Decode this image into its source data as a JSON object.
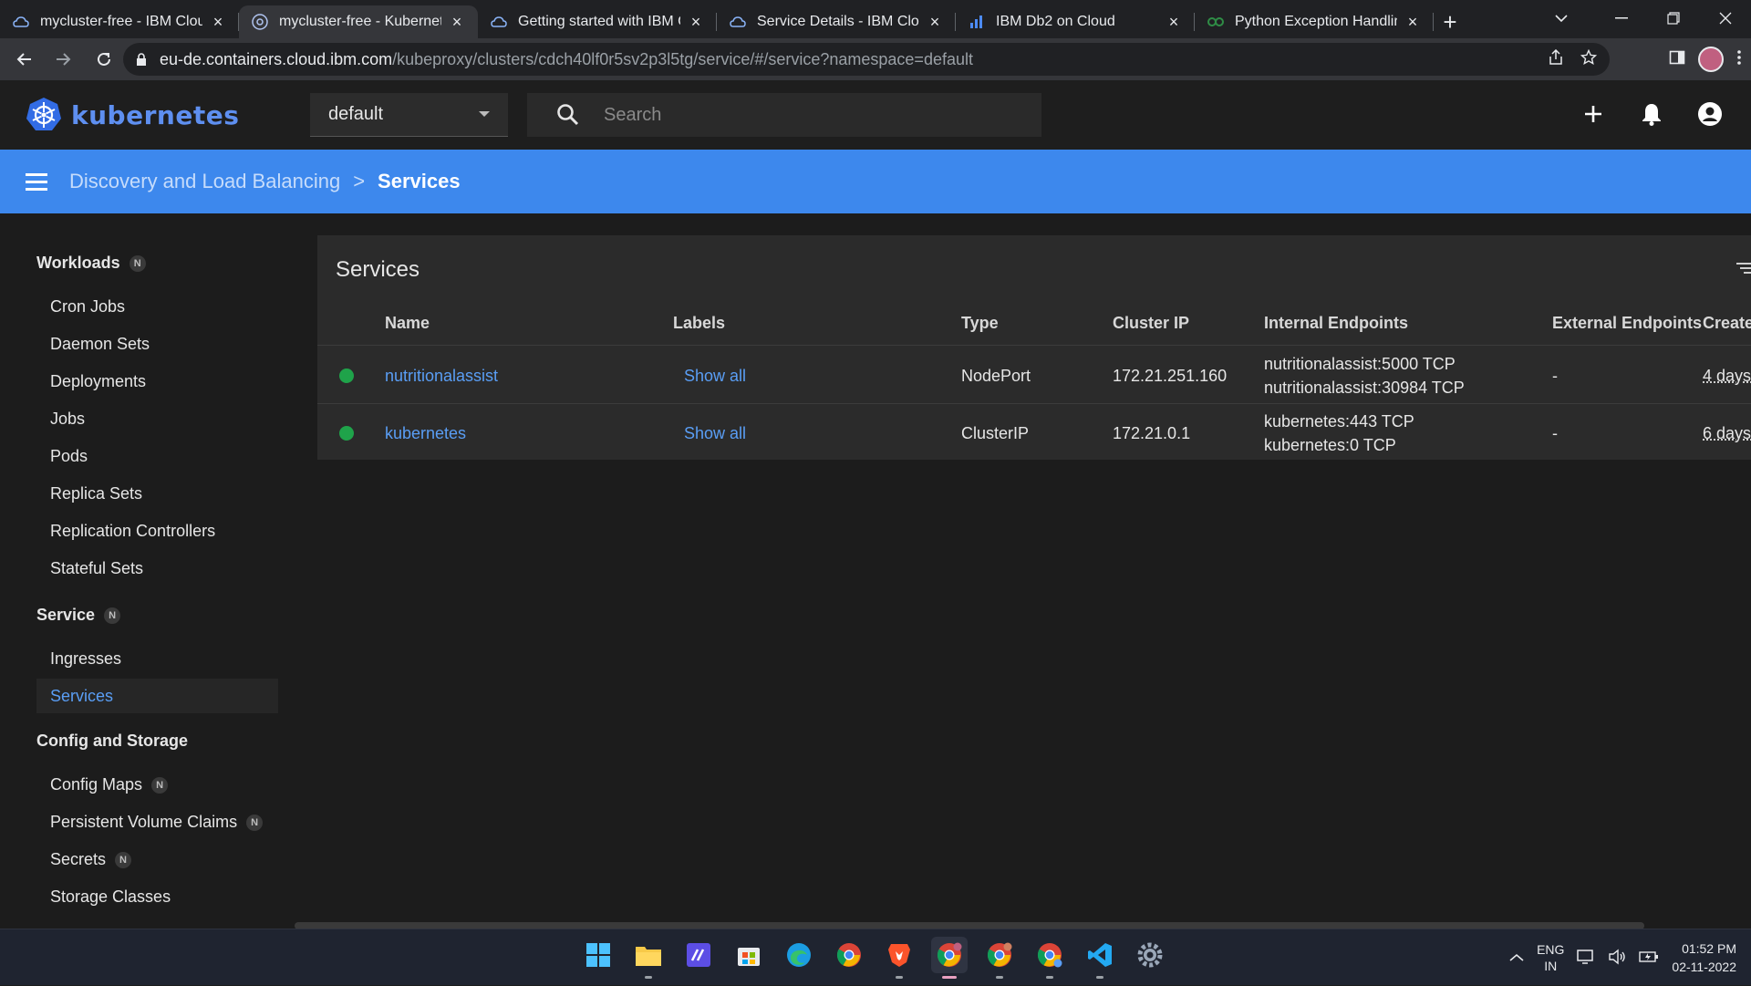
{
  "browser": {
    "tabs": [
      {
        "title": "mycluster-free - IBM Cloud",
        "active": false
      },
      {
        "title": "mycluster-free - Kubernetes",
        "active": true
      },
      {
        "title": "Getting started with IBM Cloud",
        "active": false
      },
      {
        "title": "Service Details - IBM Cloud",
        "active": false
      },
      {
        "title": "IBM Db2 on Cloud",
        "active": false
      },
      {
        "title": "Python Exception Handling",
        "active": false
      }
    ],
    "url_host": "eu-de.containers.cloud.ibm.com",
    "url_path": "/kubeproxy/clusters/cdch40lf0r5sv2p3l5tg/service/#/service?namespace=default"
  },
  "app": {
    "logo_text": "kubernetes",
    "namespace": "default",
    "search_placeholder": "Search"
  },
  "breadcrumb": {
    "parent": "Discovery and Load Balancing",
    "separator": ">",
    "current": "Services"
  },
  "sidebar": {
    "workloads": {
      "label": "Workloads",
      "badge": "N"
    },
    "workload_items": [
      "Cron Jobs",
      "Daemon Sets",
      "Deployments",
      "Jobs",
      "Pods",
      "Replica Sets",
      "Replication Controllers",
      "Stateful Sets"
    ],
    "service": {
      "label": "Service",
      "badge": "N"
    },
    "service_items": [
      "Ingresses",
      "Services"
    ],
    "config": {
      "label": "Config and Storage"
    },
    "config_items": [
      {
        "label": "Config Maps",
        "badge": "N"
      },
      {
        "label": "Persistent Volume Claims",
        "badge": "N"
      },
      {
        "label": "Secrets",
        "badge": "N"
      },
      {
        "label": "Storage Classes",
        "badge": ""
      }
    ]
  },
  "services_table": {
    "title": "Services",
    "columns": [
      "Name",
      "Labels",
      "Type",
      "Cluster IP",
      "Internal Endpoints",
      "External Endpoints",
      "Create"
    ],
    "rows": [
      {
        "name": "nutritionalassist",
        "labels": "Show all",
        "type": "NodePort",
        "cluster_ip": "172.21.251.160",
        "internal_endpoints": [
          "nutritionalassist:5000 TCP",
          "nutritionalassist:30984 TCP"
        ],
        "external_endpoints": "-",
        "created": "4 days",
        "status_color": "#1fa34a"
      },
      {
        "name": "kubernetes",
        "labels": "Show all",
        "type": "ClusterIP",
        "cluster_ip": "172.21.0.1",
        "internal_endpoints": [
          "kubernetes:443 TCP",
          "kubernetes:0 TCP"
        ],
        "external_endpoints": "-",
        "created": "6 days",
        "status_color": "#1fa34a"
      }
    ]
  },
  "taskbar": {
    "apps": [
      "windows-start",
      "file-explorer",
      "visual-studio",
      "microsoft-store",
      "edge",
      "chrome",
      "brave",
      "chrome-profile-1",
      "chrome-profile-2",
      "chrome-profile-3",
      "vscode",
      "settings"
    ],
    "lang_top": "ENG",
    "lang_bottom": "IN",
    "time": "01:52 PM",
    "date": "02-11-2022"
  },
  "colors": {
    "accent": "#3d88ed",
    "link": "#5a9ef5",
    "status_ok": "#1fa34a"
  }
}
